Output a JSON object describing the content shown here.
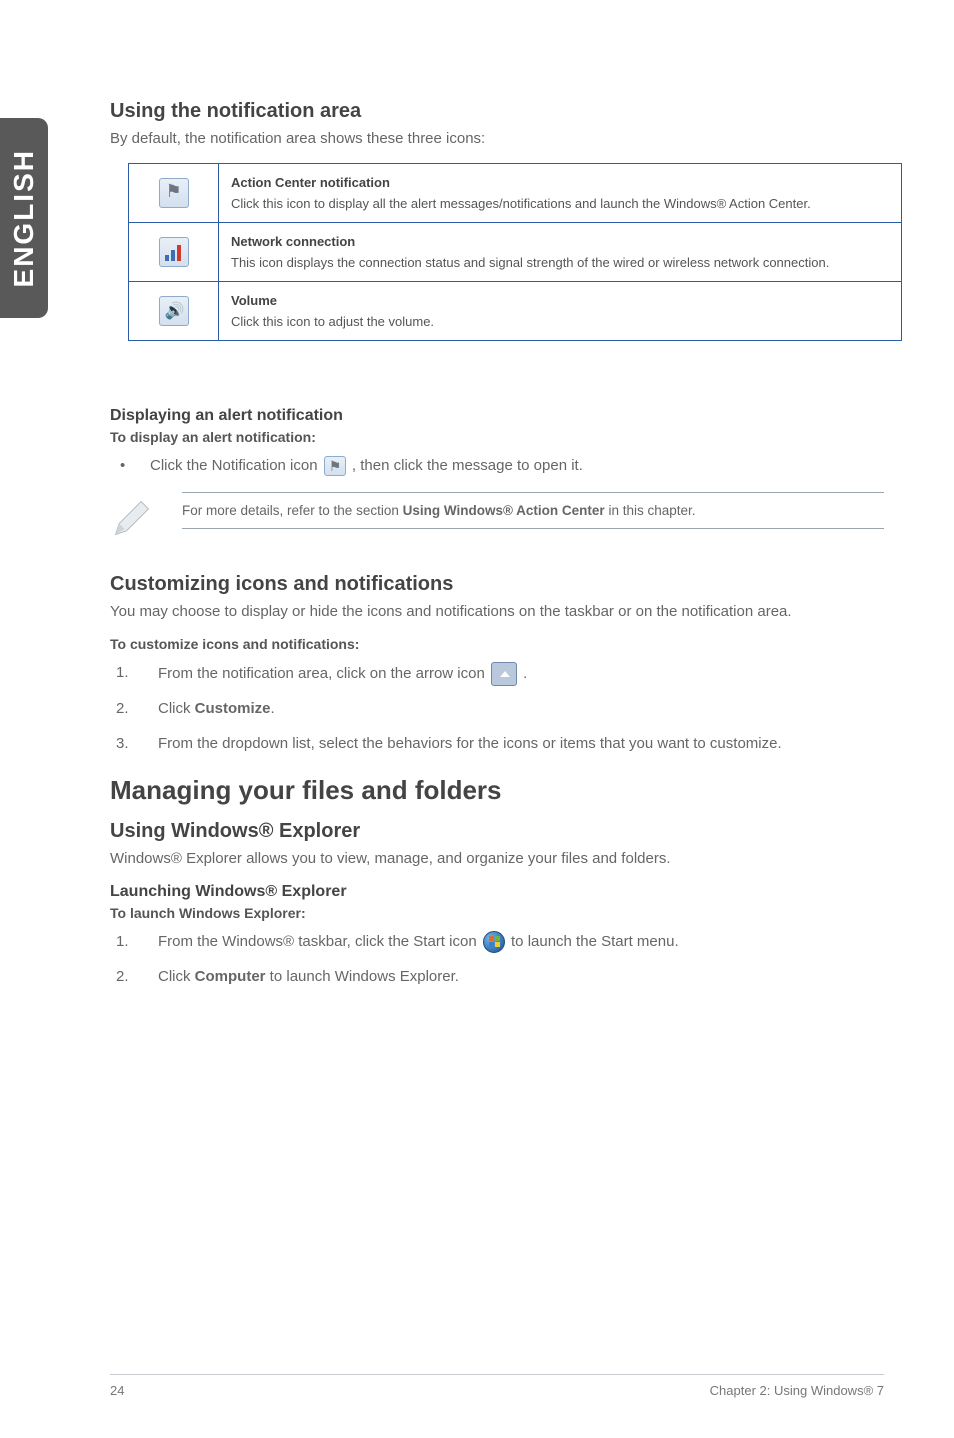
{
  "sideTab": "ENGLISH",
  "section1": {
    "heading": "Using the notification area",
    "intro": "By default, the notification area shows these three icons:"
  },
  "iconTable": {
    "rows": [
      {
        "iconName": "action-center-flag-icon",
        "title": "Action Center notification",
        "desc": "Click this icon to display all the alert messages/notifications and launch the Windows® Action Center."
      },
      {
        "iconName": "network-connection-icon",
        "title": "Network connection",
        "desc": "This icon displays the connection status and signal strength of the wired or wireless network connection."
      },
      {
        "iconName": "volume-icon",
        "title": "Volume",
        "desc": "Click this icon to adjust the volume."
      }
    ]
  },
  "alertSection": {
    "heading": "Displaying an alert notification",
    "sub": "To display an alert notification:",
    "bullet_pre": "Click the Notification icon ",
    "bullet_post": ", then click the message to open it."
  },
  "note": {
    "pre": "For more details, refer to the section ",
    "bold": "Using Windows® Action Center",
    "post": " in this chapter."
  },
  "customSection": {
    "heading": "Customizing icons and notifications",
    "intro": "You may choose to display or hide the icons and notifications on the taskbar or on the notification area.",
    "sub": "To customize icons and notifications:",
    "steps": {
      "s1_pre": "From the notification area, click on the arrow icon ",
      "s1_post": ".",
      "s2_pre": "Click ",
      "s2_bold": "Customize",
      "s2_post": ".",
      "s3": "From the dropdown list, select the behaviors for the icons or items that you want to customize."
    }
  },
  "managing": {
    "heading": "Managing your files and folders",
    "sub1": "Using Windows® Explorer",
    "intro": "Windows® Explorer allows you to view, manage, and organize your files and folders.",
    "sub2": "Launching Windows® Explorer",
    "sub3": "To launch Windows Explorer:",
    "steps": {
      "s1_pre": "From the Windows® taskbar, click the Start icon ",
      "s1_post": " to launch the Start menu.",
      "s2_pre": "Click ",
      "s2_bold": "Computer",
      "s2_post": " to launch Windows Explorer."
    }
  },
  "footer": {
    "page": "24",
    "chapter": "Chapter 2: Using Windows® 7"
  }
}
